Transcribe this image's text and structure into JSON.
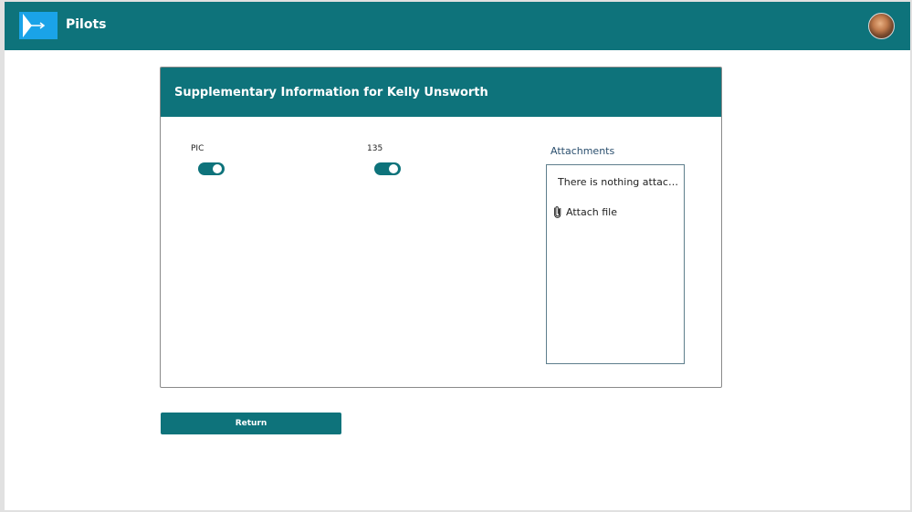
{
  "app": {
    "title": "Pilots",
    "brand_color": "#0e737b",
    "logo_color": "#1aa3e8",
    "logo_icon": "airplane-logo-icon",
    "avatar_icon": "user-avatar"
  },
  "card": {
    "title": "Supplementary Information for Kelly Unsworth",
    "toggles": [
      {
        "label": "PIC",
        "on": true
      },
      {
        "label": "135",
        "on": true
      }
    ],
    "attachments": {
      "label": "Attachments",
      "empty_text": "There is nothing attached.",
      "attach_label": "Attach file",
      "attach_icon": "paperclip-icon"
    }
  },
  "actions": {
    "return_label": "Return"
  }
}
